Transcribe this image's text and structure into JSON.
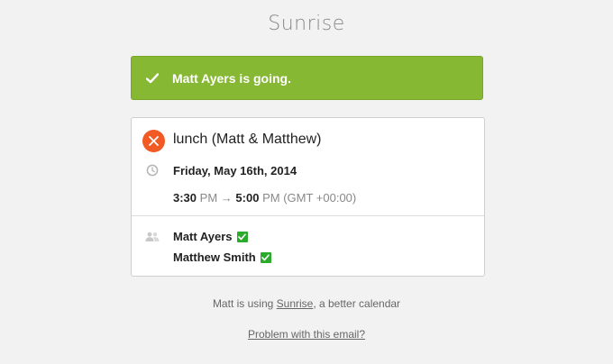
{
  "header": {
    "brand": "Sunrise"
  },
  "banner": {
    "message": "Matt Ayers is going.",
    "icon": "check-icon",
    "color": "#86b834"
  },
  "event": {
    "icon": "fork-knife-icon",
    "title": "lunch (Matt & Matthew)",
    "date": "Friday, May 16th, 2014",
    "start_time": "3:30",
    "start_period": "PM",
    "arrow": "→",
    "end_time": "5:00",
    "end_period": "PM",
    "timezone": "(GMT +00:00)"
  },
  "attendees": [
    {
      "name": "Matt Ayers",
      "status": "accepted"
    },
    {
      "name": "Matthew Smith",
      "status": "accepted"
    }
  ],
  "footer": {
    "prefix": "Matt is using",
    "link": "Sunrise",
    "suffix": ", a better calendar",
    "problem_link": "Problem with this email?"
  },
  "colors": {
    "accent_orange": "#f15a24",
    "accepted_green": "#2bab2b"
  }
}
